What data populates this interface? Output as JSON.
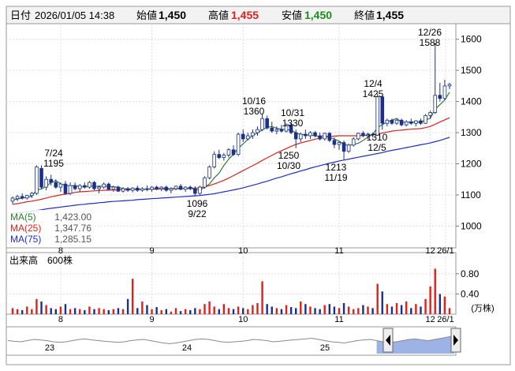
{
  "header": {
    "date_label": "日付",
    "date_value": "2026/01/05 14:38",
    "open_label": "始値",
    "open_value": "1,450",
    "high_label": "高値",
    "high_value": "1,455",
    "low_label": "安値",
    "low_value": "1,450",
    "close_label": "終値",
    "close_value": "1,455"
  },
  "legend": [
    {
      "label": "MA(5)",
      "value": "1,423.00",
      "color": "#2e7d2e"
    },
    {
      "label": "MA(25)",
      "value": "1,347.76",
      "color": "#e0201a"
    },
    {
      "label": "MA(75)",
      "value": "1,285.15",
      "color": "#1c2bd6"
    }
  ],
  "volume_title": "出来高　600株",
  "volume_unit": "(万株)",
  "colors": {
    "up": "#ffffff",
    "down": "#1b2f8c",
    "vol_up": "#e0201a",
    "vol_down": "#1b2f8c",
    "vol_flat": "#888888",
    "navigator_fill": "#9db3e6"
  },
  "chart_data": {
    "type": "candlestick",
    "price_axis": {
      "ticks": [
        1000,
        1100,
        1200,
        1300,
        1400,
        1500,
        1600
      ],
      "range": [
        930,
        1650
      ]
    },
    "month_ticks": [
      "8",
      "9",
      "10",
      "11",
      "12",
      "26/1"
    ],
    "annotations": [
      {
        "date": "7/24",
        "price": "1195"
      },
      {
        "date": "9/22",
        "price": "1096"
      },
      {
        "date": "10/16",
        "price": "1360"
      },
      {
        "date": "10/31",
        "price": "1330"
      },
      {
        "date": "10/30",
        "price": "1250"
      },
      {
        "date": "11/19",
        "price": "1213"
      },
      {
        "date": "12/4",
        "price": "1425"
      },
      {
        "date": "12/5",
        "price": "1310"
      },
      {
        "date": "12/26",
        "price": "1588"
      }
    ],
    "candles": [
      [
        1080,
        1095,
        1070,
        1090
      ],
      [
        1088,
        1100,
        1080,
        1095
      ],
      [
        1095,
        1105,
        1085,
        1090
      ],
      [
        1090,
        1100,
        1085,
        1098
      ],
      [
        1098,
        1110,
        1090,
        1105
      ],
      [
        1105,
        1195,
        1100,
        1190
      ],
      [
        1185,
        1195,
        1120,
        1125
      ],
      [
        1125,
        1160,
        1115,
        1150
      ],
      [
        1150,
        1165,
        1130,
        1140
      ],
      [
        1140,
        1150,
        1120,
        1125
      ],
      [
        1125,
        1140,
        1110,
        1135
      ],
      [
        1135,
        1145,
        1100,
        1105
      ],
      [
        1105,
        1140,
        1100,
        1130
      ],
      [
        1130,
        1140,
        1115,
        1120
      ],
      [
        1120,
        1135,
        1110,
        1130
      ],
      [
        1130,
        1140,
        1120,
        1125
      ],
      [
        1125,
        1145,
        1120,
        1140
      ],
      [
        1140,
        1145,
        1115,
        1120
      ],
      [
        1120,
        1130,
        1105,
        1125
      ],
      [
        1125,
        1140,
        1120,
        1135
      ],
      [
        1135,
        1140,
        1115,
        1118
      ],
      [
        1118,
        1130,
        1110,
        1125
      ],
      [
        1125,
        1130,
        1110,
        1112
      ],
      [
        1112,
        1125,
        1108,
        1120
      ],
      [
        1120,
        1125,
        1110,
        1115
      ],
      [
        1115,
        1125,
        1108,
        1122
      ],
      [
        1122,
        1130,
        1110,
        1115
      ],
      [
        1115,
        1125,
        1110,
        1120
      ],
      [
        1120,
        1130,
        1112,
        1118
      ],
      [
        1118,
        1128,
        1110,
        1125
      ],
      [
        1125,
        1130,
        1115,
        1120
      ],
      [
        1120,
        1128,
        1112,
        1125
      ],
      [
        1125,
        1130,
        1110,
        1115
      ],
      [
        1115,
        1125,
        1105,
        1120
      ],
      [
        1120,
        1130,
        1115,
        1128
      ],
      [
        1128,
        1135,
        1115,
        1118
      ],
      [
        1118,
        1128,
        1110,
        1125
      ],
      [
        1125,
        1130,
        1115,
        1120
      ],
      [
        1120,
        1128,
        1096,
        1105
      ],
      [
        1105,
        1130,
        1100,
        1125
      ],
      [
        1125,
        1160,
        1120,
        1155
      ],
      [
        1155,
        1195,
        1150,
        1190
      ],
      [
        1190,
        1240,
        1185,
        1230
      ],
      [
        1230,
        1245,
        1215,
        1220
      ],
      [
        1220,
        1235,
        1210,
        1228
      ],
      [
        1228,
        1250,
        1220,
        1245
      ],
      [
        1245,
        1260,
        1225,
        1230
      ],
      [
        1230,
        1300,
        1225,
        1295
      ],
      [
        1295,
        1310,
        1270,
        1280
      ],
      [
        1280,
        1300,
        1275,
        1290
      ],
      [
        1290,
        1310,
        1280,
        1300
      ],
      [
        1300,
        1320,
        1290,
        1310
      ],
      [
        1310,
        1360,
        1305,
        1345
      ],
      [
        1345,
        1355,
        1310,
        1315
      ],
      [
        1315,
        1335,
        1300,
        1305
      ],
      [
        1305,
        1320,
        1295,
        1310
      ],
      [
        1310,
        1325,
        1300,
        1305
      ],
      [
        1305,
        1330,
        1300,
        1325
      ],
      [
        1325,
        1330,
        1295,
        1300
      ],
      [
        1300,
        1310,
        1250,
        1280
      ],
      [
        1280,
        1300,
        1270,
        1295
      ],
      [
        1295,
        1310,
        1280,
        1290
      ],
      [
        1290,
        1305,
        1280,
        1300
      ],
      [
        1300,
        1305,
        1285,
        1290
      ],
      [
        1290,
        1300,
        1275,
        1280
      ],
      [
        1280,
        1300,
        1275,
        1298
      ],
      [
        1298,
        1302,
        1270,
        1275
      ],
      [
        1275,
        1285,
        1250,
        1262
      ],
      [
        1262,
        1272,
        1245,
        1268
      ],
      [
        1268,
        1275,
        1213,
        1240
      ],
      [
        1240,
        1265,
        1235,
        1260
      ],
      [
        1260,
        1285,
        1255,
        1280
      ],
      [
        1280,
        1300,
        1275,
        1298
      ],
      [
        1298,
        1305,
        1285,
        1290
      ],
      [
        1290,
        1300,
        1280,
        1295
      ],
      [
        1295,
        1300,
        1285,
        1292
      ],
      [
        1292,
        1425,
        1290,
        1415
      ],
      [
        1415,
        1420,
        1310,
        1330
      ],
      [
        1330,
        1345,
        1320,
        1340
      ],
      [
        1340,
        1345,
        1325,
        1330
      ],
      [
        1330,
        1345,
        1325,
        1340
      ],
      [
        1340,
        1345,
        1320,
        1325
      ],
      [
        1325,
        1340,
        1320,
        1335
      ],
      [
        1335,
        1345,
        1325,
        1330
      ],
      [
        1330,
        1340,
        1320,
        1338
      ],
      [
        1338,
        1345,
        1325,
        1330
      ],
      [
        1330,
        1360,
        1328,
        1355
      ],
      [
        1355,
        1370,
        1345,
        1365
      ],
      [
        1365,
        1588,
        1360,
        1420
      ],
      [
        1420,
        1460,
        1400,
        1410
      ],
      [
        1410,
        1470,
        1405,
        1450
      ],
      [
        1450,
        1460,
        1440,
        1455
      ]
    ],
    "volumes": [
      0.12,
      0.1,
      0.08,
      0.15,
      0.1,
      0.3,
      0.25,
      0.18,
      0.12,
      0.1,
      0.15,
      0.2,
      0.1,
      0.12,
      0.1,
      0.08,
      0.15,
      0.1,
      0.12,
      0.1,
      0.08,
      0.1,
      0.12,
      0.1,
      0.3,
      0.7,
      0.12,
      0.25,
      0.18,
      0.1,
      0.14,
      0.08,
      0.1,
      0.05,
      0.12,
      0.06,
      0.1,
      0.08,
      0.12,
      0.1,
      0.2,
      0.25,
      0.15,
      0.1,
      0.2,
      0.12,
      0.1,
      0.15,
      0.12,
      0.1,
      0.18,
      0.22,
      0.65,
      0.2,
      0.15,
      0.12,
      0.1,
      0.18,
      0.14,
      0.12,
      0.25,
      0.2,
      0.15,
      0.12,
      0.1,
      0.18,
      0.2,
      0.15,
      0.12,
      0.22,
      0.15,
      0.1,
      0.12,
      0.18,
      0.15,
      0.12,
      0.6,
      0.45,
      0.2,
      0.15,
      0.22,
      0.18,
      0.25,
      0.12,
      0.2,
      0.15,
      0.3,
      0.55,
      0.9,
      0.4,
      0.35,
      0.12
    ],
    "ma5": [
      1084,
      1087,
      1090,
      1092,
      1096,
      1116,
      1119,
      1127,
      1140,
      1146,
      1135,
      1131,
      1129,
      1130,
      1126,
      1126,
      1129,
      1127,
      1128,
      1128,
      1128,
      1126,
      1125,
      1120,
      1119,
      1118,
      1119,
      1117,
      1118,
      1120,
      1120,
      1121,
      1121,
      1120,
      1122,
      1121,
      1120,
      1121,
      1118,
      1115,
      1125,
      1135,
      1155,
      1170,
      1195,
      1215,
      1231,
      1250,
      1264,
      1278,
      1291,
      1299,
      1309,
      1317,
      1320,
      1314,
      1311,
      1310,
      1308,
      1300,
      1294,
      1293,
      1292,
      1290,
      1287,
      1291,
      1285,
      1279,
      1273,
      1262,
      1259,
      1262,
      1266,
      1275,
      1286,
      1294,
      1316,
      1326,
      1334,
      1340,
      1346,
      1333,
      1334,
      1334,
      1334,
      1333,
      1341,
      1346,
      1375,
      1390,
      1405,
      1430
    ],
    "ma25": [
      1070,
      1072,
      1075,
      1078,
      1080,
      1083,
      1086,
      1090,
      1094,
      1097,
      1100,
      1103,
      1105,
      1108,
      1110,
      1111,
      1112,
      1113,
      1114,
      1115,
      1115,
      1116,
      1116,
      1117,
      1117,
      1117,
      1118,
      1118,
      1118,
      1118,
      1118,
      1119,
      1119,
      1119,
      1120,
      1120,
      1121,
      1122,
      1122,
      1123,
      1126,
      1130,
      1135,
      1141,
      1147,
      1154,
      1162,
      1170,
      1178,
      1186,
      1194,
      1202,
      1211,
      1219,
      1227,
      1235,
      1242,
      1249,
      1256,
      1262,
      1267,
      1271,
      1275,
      1279,
      1282,
      1285,
      1287,
      1289,
      1290,
      1290,
      1290,
      1290,
      1290,
      1291,
      1292,
      1293,
      1296,
      1299,
      1302,
      1305,
      1307,
      1308,
      1310,
      1311,
      1312,
      1313,
      1316,
      1320,
      1327,
      1334,
      1341,
      1348
    ],
    "ma75": [
      1040,
      1042,
      1044,
      1046,
      1048,
      1050,
      1052,
      1055,
      1057,
      1059,
      1061,
      1063,
      1065,
      1067,
      1069,
      1070,
      1072,
      1073,
      1075,
      1076,
      1078,
      1079,
      1080,
      1081,
      1082,
      1083,
      1085,
      1086,
      1087,
      1088,
      1089,
      1090,
      1091,
      1092,
      1093,
      1094,
      1095,
      1096,
      1097,
      1098,
      1100,
      1102,
      1104,
      1107,
      1110,
      1113,
      1116,
      1119,
      1123,
      1127,
      1131,
      1135,
      1140,
      1144,
      1149,
      1154,
      1158,
      1163,
      1168,
      1172,
      1177,
      1181,
      1186,
      1190,
      1194,
      1198,
      1202,
      1205,
      1209,
      1212,
      1215,
      1218,
      1221,
      1224,
      1227,
      1230,
      1233,
      1236,
      1240,
      1243,
      1246,
      1249,
      1252,
      1255,
      1258,
      1261,
      1264,
      1267,
      1271,
      1275,
      1280,
      1285
    ]
  },
  "navigator": {
    "labels": [
      "23",
      "24",
      "25"
    ],
    "profile": [
      0.55,
      0.52,
      0.5,
      0.55,
      0.6,
      0.58,
      0.55,
      0.5,
      0.48,
      0.5,
      0.55,
      0.6,
      0.62,
      0.58,
      0.55,
      0.52,
      0.5,
      0.48,
      0.5,
      0.55,
      0.58,
      0.6,
      0.55,
      0.5,
      0.45,
      0.42,
      0.45,
      0.5,
      0.55,
      0.6,
      0.62,
      0.6,
      0.55,
      0.5,
      0.48,
      0.5,
      0.52,
      0.55,
      0.6,
      0.58,
      0.55,
      0.5,
      0.52,
      0.55,
      0.58,
      0.6,
      0.62,
      0.65,
      0.6,
      0.55,
      0.5,
      0.48,
      0.45,
      0.5,
      0.55,
      0.58,
      0.6,
      0.55,
      0.5,
      0.48,
      0.5,
      0.55,
      0.6,
      0.62,
      0.58,
      0.55,
      0.6,
      0.65,
      0.7,
      0.75
    ],
    "selected_from": 0.83
  }
}
